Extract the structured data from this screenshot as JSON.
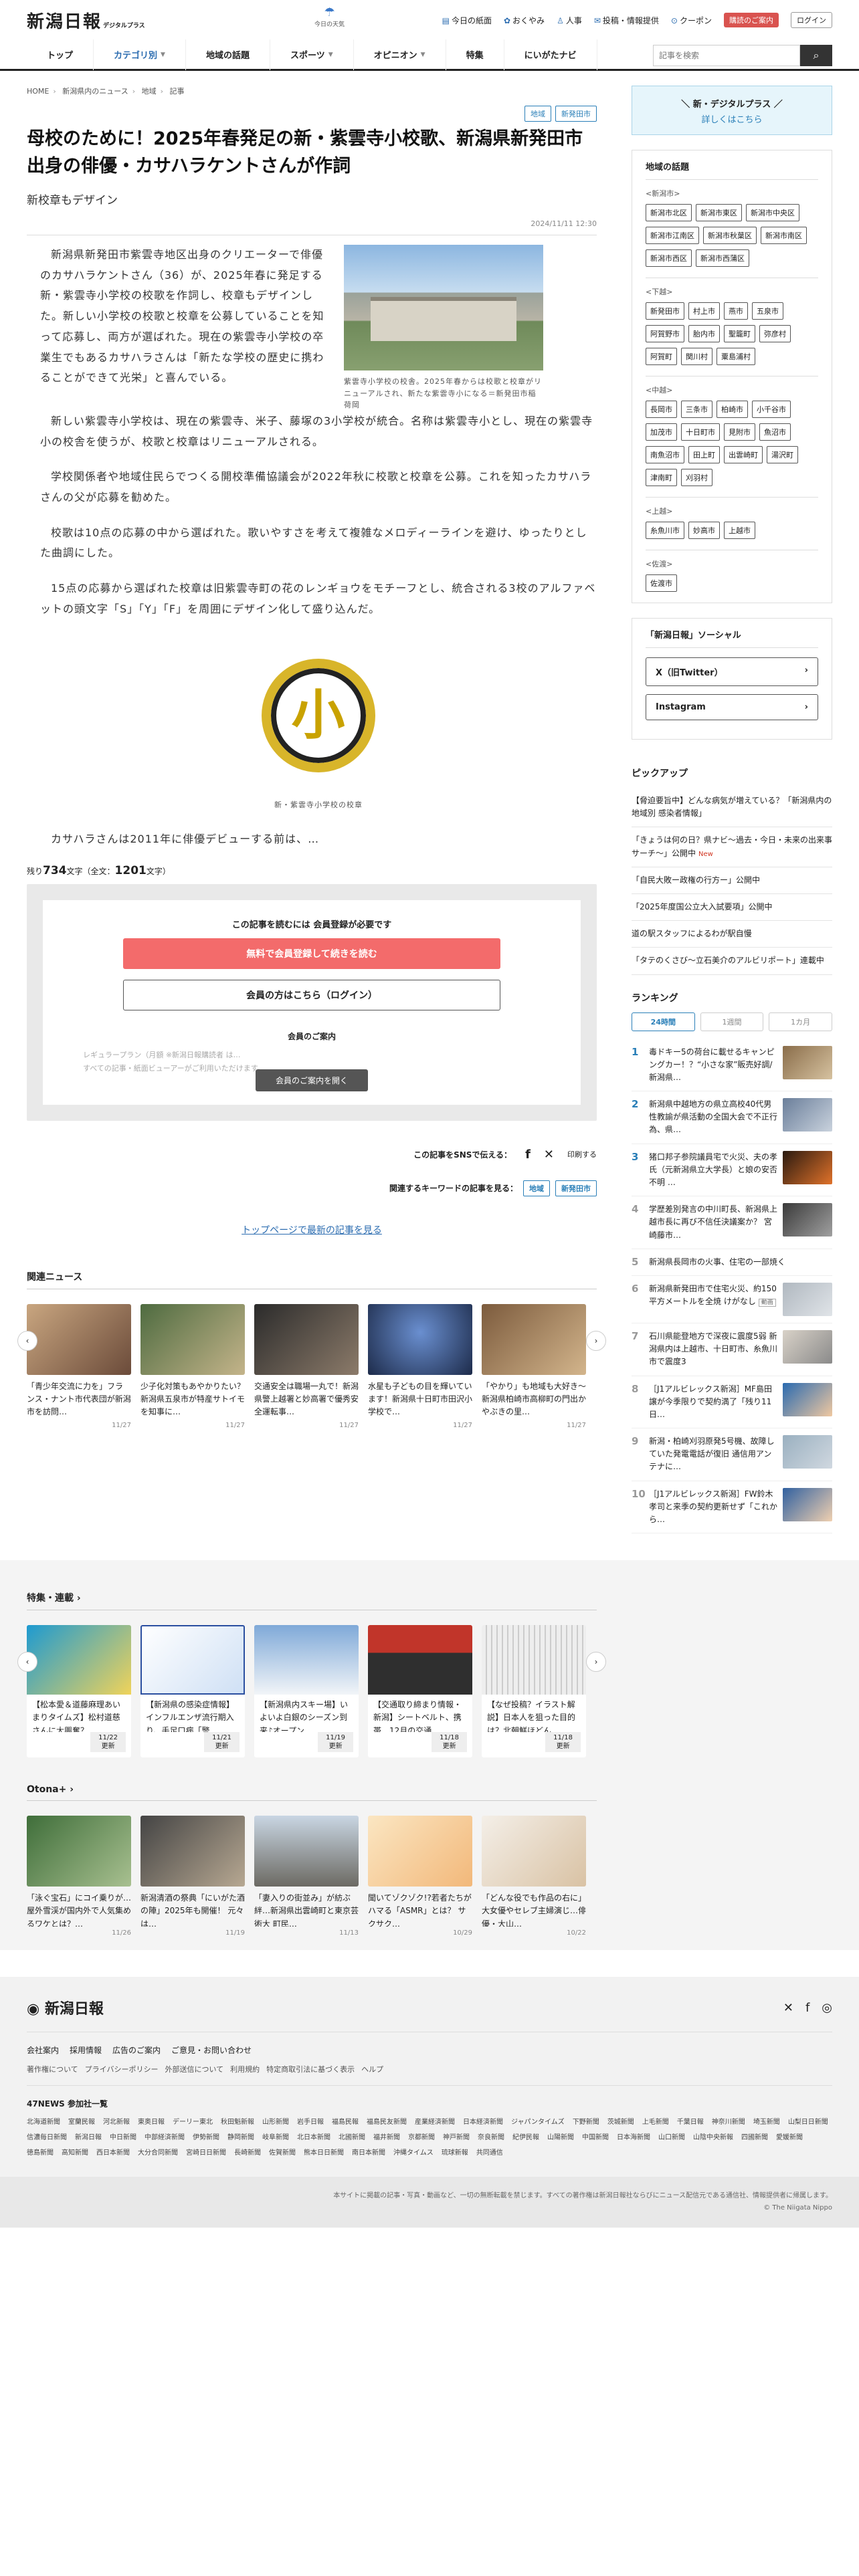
{
  "header": {
    "logo": "新潟日報",
    "logo_sub": "デジタルプラス",
    "weather": "今日の天気",
    "links": [
      "今日の紙面",
      "おくやみ",
      "人事",
      "投稿・情報提供",
      "クーポン"
    ],
    "join": "購読のご案内",
    "login": "ログイン"
  },
  "nav": {
    "items": [
      "トップ",
      "カテゴリ別",
      "地域の話題",
      "スポーツ",
      "オピニオン",
      "特集",
      "にいがたナビ"
    ],
    "search_placeholder": "記事を検索"
  },
  "crumb": [
    "HOME",
    "新潟県内のニュース",
    "地域",
    "記事"
  ],
  "article": {
    "tags": [
      "地域",
      "新発田市"
    ],
    "title": "母校のために！2025年春発足の新・紫雲寺小校歌、新潟県新発田市出身の俳優・カサハラケントさんが作詞",
    "subtitle": "新校章もデザイン",
    "date": "2024/11/11 12:30",
    "lead": "新潟県新発田市紫雲寺地区出身のクリエーターで俳優のカサハラケントさん（36）が、2025年春に発足する新・紫雲寺小学校の校歌を作詞し、校章もデザインした。新しい小学校の校歌と校章を公募していることを知って応募し、両方が選ばれた。現在の紫雲寺小学校の卒業生でもあるカサハラさんは「新たな学校の歴史に携わることができて光栄」と喜んでいる。",
    "photo_caption": "紫雲寺小学校の校舎。2025年春からは校歌と校章がリニューアルされ、新たな紫雲寺小になる＝新発田市稲荷岡",
    "paragraphs": [
      "新しい紫雲寺小学校は、現在の紫雲寺、米子、藤塚の3小学校が統合。名称は紫雲寺小とし、現在の紫雲寺小の校舎を使うが、校歌と校章はリニューアルされる。",
      "学校関係者や地域住民らでつくる開校準備協議会が2022年秋に校歌と校章を公募。これを知ったカサハラさんの父が応募を勧めた。",
      "校歌は10点の応募の中から選ばれた。歌いやすさを考えて複雑なメロディーラインを避け、ゆったりとした曲調にした。",
      "15点の応募から選ばれた校章は旧紫雲寺町の花のレンギョウをモチーフとし、統合される3校のアルファベットの頭文字「S」「Y」「F」を周囲にデザイン化して盛り込んだ。"
    ],
    "mark_char": "小",
    "mark_caption": "新・紫雲寺小学校の校章",
    "tail": "カサハラさんは2011年に俳優デビューする前は、…",
    "remain_label": "残り",
    "remain": "734",
    "remain_unit": "文字（全文：",
    "total": "1201",
    "total_unit": "文字）"
  },
  "paywall": {
    "need": "この記事を読むには 会員登録が必要です",
    "register": "無料で会員登録して続きを読む",
    "login": "会員の方はこちら（ログイン）",
    "guide": "会員のご案内",
    "blur1": "レギュラープラン（月額 ※新潟日報購読者 は…",
    "blur2": "すべての記事・紙面ビューアーがご利用いただけます。",
    "guide_btn": "会員のご案内を開く"
  },
  "share": {
    "label": "この記事をSNSで伝える：",
    "print": "印刷する",
    "kw_label": "関連するキーワードの記事を見る：",
    "kw": [
      "地域",
      "新発田市"
    ]
  },
  "toplink": "トップページで最新の記事を見る",
  "related": {
    "title": "関連ニュース",
    "items": [
      {
        "t": "「青少年交流に力を」フランス・ナント市代表団が新潟市を訪問…",
        "d": "11/27"
      },
      {
        "t": "少子化対策もあやかりたい？新潟県五泉市が特産サトイモを知事に…",
        "d": "11/27"
      },
      {
        "t": "交通安全は職場一丸で！新潟県警上越署と妙高署で優秀安全運転事…",
        "d": "11/27"
      },
      {
        "t": "水星も子どもの目を輝いています！新潟県十日町市田沢小学校で…",
        "d": "11/27"
      },
      {
        "t": "「やかり」も地域も大好き〜新潟県柏崎市高柳町の門出かやぶきの里…",
        "d": "11/27"
      }
    ]
  },
  "features": {
    "title": "特集・連載",
    "items": [
      {
        "t": "【松本愛＆道藤麻理あいまりタイムズ】松村道慈さんに大興奮？…",
        "d": "11/22",
        "b": "更新"
      },
      {
        "t": "【新潟県の感染症情報】インフルエンザ流行期入り、手足口病「警…",
        "d": "11/21",
        "b": "更新"
      },
      {
        "t": "【新潟県内スキー場】いよいよ白銀のシーズン到来♪オープン…",
        "d": "11/19",
        "b": "更新"
      },
      {
        "t": "【交通取り締まり情報・新潟】シートベルト、携帯…12月の交通…",
        "d": "11/18",
        "b": "更新"
      },
      {
        "t": "【なぜ投稿？イラスト解説】日本人を狙った目的は？北朝鮮ほどん…",
        "d": "11/18",
        "b": "更新"
      }
    ]
  },
  "otona": {
    "title": "Otona+",
    "items": [
      {
        "t": "「泳ぐ宝石」にコイ乗りが…屋外雪渓が国内外で人気集めるワケとは？…",
        "d": "11/26"
      },
      {
        "t": "新潟清酒の祭典「にいがた酒の陣」2025年も開催！ 元々は…",
        "d": "11/19"
      },
      {
        "t": "「妻入りの街並み」が紡ぶ絆…新潟県出雲崎町と東京芸術大 町民…",
        "d": "11/13"
      },
      {
        "t": "聞いてゾクゾク!?若者たちがハマる「ASMR」とは？ サクサク…",
        "d": "10/29"
      },
      {
        "t": "「どんな役でも作品の右に」大女優やセレブ主婦演じ…俳優・大山…",
        "d": "10/22"
      }
    ]
  },
  "side": {
    "promo_title": "＼ 新・デジタルプラス ／",
    "promo_sub": "詳しくはこちら",
    "topics_title": "地域の話題",
    "regions": [
      {
        "name": "<新潟市>",
        "items": [
          "新潟市北区",
          "新潟市東区",
          "新潟市中央区",
          "新潟市江南区",
          "新潟市秋葉区",
          "新潟市南区",
          "新潟市西区",
          "新潟市西蒲区"
        ]
      },
      {
        "name": "<下越>",
        "items": [
          "新発田市",
          "村上市",
          "燕市",
          "五泉市",
          "阿賀野市",
          "胎内市",
          "聖籠町",
          "弥彦村",
          "阿賀町",
          "関川村",
          "粟島浦村"
        ]
      },
      {
        "name": "<中越>",
        "items": [
          "長岡市",
          "三条市",
          "柏崎市",
          "小千谷市",
          "加茂市",
          "十日町市",
          "見附市",
          "魚沼市",
          "南魚沼市",
          "田上町",
          "出雲崎町",
          "湯沢町",
          "津南町",
          "刈羽村"
        ]
      },
      {
        "name": "<上越>",
        "items": [
          "糸魚川市",
          "妙高市",
          "上越市"
        ]
      },
      {
        "name": "<佐渡>",
        "items": [
          "佐渡市"
        ]
      }
    ],
    "sns_title": "「新潟日報」ソーシャル",
    "sns": [
      "X（旧Twitter）",
      "Instagram"
    ],
    "pickup_title": "ピックアップ",
    "pickup": [
      "【脅迫要旨中】どんな病気が増えている？「新潟県内の地域別 感染者情報」",
      "「きょうは何の日？県ナビ〜過去・今日・未来の出来事サーチ〜」公開中",
      "「自民大敗ー政権の行方ー」公開中",
      "「2025年度国公立大入試要項」公開中",
      "道の駅スタッフによるわが駅自慢",
      "「タテのくさび〜立石美介のアルビリポート」連載中"
    ],
    "pickup_new": "New",
    "ranking_title": "ランキング",
    "tabs": [
      "24時間",
      "1週間",
      "1カ月"
    ],
    "ranking": [
      {
        "n": "1",
        "t": "毒ドキー5の荷台に載せるキャンピングカー！？“小さな家”販売好調/新潟県…"
      },
      {
        "n": "2",
        "t": "新潟県中越地方の県立高校40代男性教諭が県活動の全国大会で不正行為、県…"
      },
      {
        "n": "3",
        "t": "猪口邦子参院議員宅で火災、夫の孝氏（元新潟県立大学長）と娘の安否不明 …"
      },
      {
        "n": "4",
        "t": "学歴差別発言の中川町長、新潟県上越市長に再び不信任決議案か？ 宮崎藤市…"
      },
      {
        "n": "5",
        "t": "新潟県長岡市の火事、住宅の一部焼く"
      },
      {
        "n": "6",
        "t": "新潟県新発田市で住宅火災、約150平方メートルを全焼 けがなし",
        "b": "動画"
      },
      {
        "n": "7",
        "t": "石川県能登地方で深夜に震度5弱 新潟県内は上越市、十日町市、糸魚川市で震度3"
      },
      {
        "n": "8",
        "t": "［J1アルビレックス新潟］MF島田譲が今季限りで契約満了「残り11日…"
      },
      {
        "n": "9",
        "t": "新潟・柏崎刈羽原発5号機、故障していた発電電話が復旧 通信用アンテナに…"
      },
      {
        "n": "10",
        "t": "［J1アルビレックス新潟］FW鈴木孝司と来季の契約更新せず「これから…"
      }
    ]
  },
  "footer": {
    "logo": "新潟日報",
    "links": [
      "会社案内",
      "採用情報",
      "広告のご案内",
      "ご意見・お問い合わせ"
    ],
    "links2": [
      "著作権について",
      "プライバシーポリシー",
      "外部送信について",
      "利用規約",
      "特定商取引法に基づく表示",
      "ヘルプ"
    ],
    "news47": "47NEWS 参加社一覧",
    "papers": [
      "北海道新聞",
      "室蘭民報",
      "河北新報",
      "東奥日報",
      "デーリー東北",
      "秋田魁新報",
      "山形新聞",
      "岩手日報",
      "福島民報",
      "福島民友新聞",
      "産業経済新聞",
      "日本経済新聞",
      "ジャパンタイムズ",
      "下野新聞",
      "茨城新聞",
      "上毛新聞",
      "千葉日報",
      "神奈川新聞",
      "埼玉新聞",
      "山梨日日新聞",
      "信濃毎日新聞",
      "新潟日報",
      "中日新聞",
      "中部経済新聞",
      "伊勢新聞",
      "静岡新聞",
      "岐阜新聞",
      "北日本新聞",
      "北國新聞",
      "福井新聞",
      "京都新聞",
      "神戸新聞",
      "奈良新聞",
      "紀伊民報",
      "山陽新聞",
      "中国新聞",
      "日本海新聞",
      "山口新聞",
      "山陰中央新報",
      "四國新聞",
      "愛媛新聞",
      "徳島新聞",
      "高知新聞",
      "西日本新聞",
      "大分合同新聞",
      "宮崎日日新聞",
      "長崎新聞",
      "佐賀新聞",
      "熊本日日新聞",
      "南日本新聞",
      "沖縄タイムス",
      "琉球新報",
      "共同通信"
    ],
    "notice": "本サイトに掲載の記事・写真・動画など、一切の無断転載を禁じます。すべての著作権は新潟日報社ならびにニュース配信元である通信社、情報提供者に帰属します。",
    "copy": "© The Niigata Nippo"
  }
}
